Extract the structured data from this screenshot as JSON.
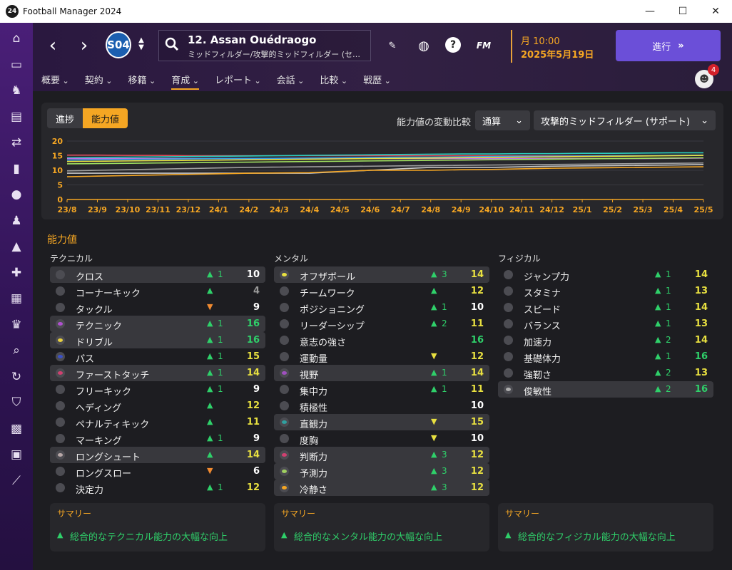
{
  "window": {
    "title": "Football Manager 2024",
    "logo_text": "24",
    "minimize": "—",
    "maximize": "☐",
    "close": "✕"
  },
  "sidebar": [
    "home-icon",
    "inbox-icon",
    "squad-icon",
    "tactics-icon",
    "transfers-icon",
    "team-report-icon",
    "scouting-icon",
    "staff-icon",
    "training-icon",
    "medical-icon",
    "schedule-icon",
    "competitions-icon",
    "search-icon",
    "transfer-centre-icon",
    "club-info-icon",
    "finances-icon",
    "dev-centre-icon",
    "career-icon"
  ],
  "header": {
    "crest_text": "S04",
    "player_name": "12. Assan Ouédraogo",
    "player_position": "ミッドフィルダー/攻撃的ミッドフィルダー (セ…",
    "time": "月 10:00",
    "date": "2025年5月19日",
    "continue_label": "進行",
    "fm_label": "FM",
    "help_label": "?",
    "notifications": "4"
  },
  "tabs": [
    "概要",
    "契約",
    "移籍",
    "育成",
    "レポート",
    "会話",
    "比較",
    "戦歴"
  ],
  "active_tab": 3,
  "segment": [
    "進捗",
    "能力値"
  ],
  "compare_label": "能力値の変動比較",
  "dropdown1": "通算",
  "dropdown2": "攻撃的ミッドフィルダー (サポート)",
  "chart_data": {
    "type": "line",
    "categories": [
      "23/8",
      "23/9",
      "23/10",
      "23/11",
      "23/12",
      "24/1",
      "24/2",
      "24/3",
      "24/4",
      "24/5",
      "24/6",
      "24/7",
      "24/8",
      "24/9",
      "24/10",
      "24/11",
      "24/12",
      "25/1",
      "25/2",
      "25/3",
      "25/4",
      "25/5"
    ],
    "ylim": [
      0,
      20
    ],
    "yticks": [
      0,
      5,
      10,
      15,
      20
    ],
    "grid": true,
    "series": [
      {
        "color": "#e04858",
        "values": [
          15.2,
          15.2,
          15.1,
          15.1,
          15.0,
          15.0,
          15.0,
          15.0,
          15.0,
          15.0,
          15.0,
          15.0,
          15.0,
          15.0,
          15.0,
          15.0,
          15.0,
          15.0,
          15.0,
          15.0,
          15.0,
          15.1
        ]
      },
      {
        "color": "#2ad0c0",
        "values": [
          14.3,
          14.4,
          14.5,
          14.6,
          14.7,
          14.8,
          14.9,
          15.0,
          15.1,
          15.2,
          15.3,
          15.4,
          15.5,
          15.6,
          15.6,
          15.7,
          15.7,
          15.8,
          15.8,
          15.9,
          16.0,
          16.0
        ]
      },
      {
        "color": "#c070e8",
        "values": [
          14.0,
          14.0,
          14.0,
          14.0,
          14.0,
          14.0,
          14.0,
          14.0,
          14.0,
          14.0,
          14.0,
          14.0,
          14.0,
          14.0,
          14.0,
          14.0,
          14.0,
          14.0,
          14.0,
          14.0,
          14.1,
          14.2
        ]
      },
      {
        "color": "#3aa0e8",
        "values": [
          13.5,
          13.6,
          13.7,
          13.8,
          13.9,
          14.0,
          14.0,
          14.1,
          14.2,
          14.3,
          14.4,
          14.5,
          14.5,
          14.6,
          14.7,
          14.8,
          14.8,
          14.9,
          15.0,
          15.0,
          15.1,
          15.2
        ]
      },
      {
        "color": "#e8e040",
        "values": [
          13.0,
          13.1,
          13.2,
          13.3,
          13.4,
          13.5,
          13.6,
          13.7,
          13.8,
          13.9,
          14.0,
          14.1,
          14.2,
          14.3,
          14.4,
          14.5,
          14.6,
          14.7,
          14.8,
          14.9,
          15.0,
          15.1
        ]
      },
      {
        "color": "#a0e060",
        "values": [
          12.2,
          12.3,
          12.4,
          12.5,
          12.6,
          12.7,
          12.8,
          12.9,
          13.0,
          13.1,
          13.2,
          13.3,
          13.4,
          13.5,
          13.6,
          13.7,
          13.8,
          13.9,
          14.0,
          14.1,
          14.2,
          14.3
        ]
      },
      {
        "color": "#9e9e9e",
        "values": [
          9.8,
          10.0,
          10.2,
          10.4,
          10.6,
          10.8,
          11.0,
          11.1,
          11.2,
          11.3,
          11.4,
          11.5,
          11.6,
          11.7,
          11.8,
          11.9,
          12.0,
          12.1,
          12.2,
          12.3,
          12.4,
          12.5
        ]
      },
      {
        "color": "#c8c8c8",
        "values": [
          9.0,
          9.0,
          9.0,
          9.0,
          9.0,
          9.0,
          9.0,
          9.0,
          9.0,
          9.5,
          10.0,
          10.5,
          11.0,
          11.0,
          11.0,
          11.2,
          11.4,
          11.5,
          11.6,
          11.7,
          11.8,
          12.0
        ]
      },
      {
        "color": "#f5a623",
        "values": [
          7.8,
          8.0,
          8.2,
          8.4,
          8.6,
          8.8,
          9.0,
          9.1,
          9.2,
          9.6,
          10.0,
          10.0,
          10.0,
          10.2,
          10.3,
          10.5,
          10.7,
          10.8,
          10.9,
          11.0,
          11.1,
          11.2
        ]
      }
    ]
  },
  "attributes_title": "能力値",
  "columns": [
    {
      "title": "テクニカル",
      "rows": [
        {
          "name": "クロス",
          "arrow": "▲",
          "arrow_color": "#2fd06a",
          "change": "1",
          "value": "10",
          "value_color": "#ffffff",
          "hl": true,
          "icon": ""
        },
        {
          "name": "コーナーキック",
          "arrow": "▲",
          "arrow_color": "#2fd06a",
          "change": "",
          "value": "4",
          "value_color": "#9a9a9a",
          "hl": false,
          "icon": ""
        },
        {
          "name": "タックル",
          "arrow": "▼",
          "arrow_color": "#f08a30",
          "change": "",
          "value": "9",
          "value_color": "#ffffff",
          "hl": false,
          "icon": ""
        },
        {
          "name": "テクニック",
          "arrow": "▲",
          "arrow_color": "#2fd06a",
          "change": "1",
          "value": "16",
          "value_color": "#2fd06a",
          "hl": true,
          "icon": "#b050d0"
        },
        {
          "name": "ドリブル",
          "arrow": "▲",
          "arrow_color": "#2fd06a",
          "change": "1",
          "value": "16",
          "value_color": "#2fd06a",
          "hl": true,
          "icon": "#e8d040"
        },
        {
          "name": "パス",
          "arrow": "▲",
          "arrow_color": "#2fd06a",
          "change": "1",
          "value": "15",
          "value_color": "#e8e040",
          "hl": false,
          "icon": "#3a50c8"
        },
        {
          "name": "ファーストタッチ",
          "arrow": "▲",
          "arrow_color": "#2fd06a",
          "change": "1",
          "value": "14",
          "value_color": "#e8e040",
          "hl": true,
          "icon": "#d04070"
        },
        {
          "name": "フリーキック",
          "arrow": "▲",
          "arrow_color": "#2fd06a",
          "change": "1",
          "value": "9",
          "value_color": "#ffffff",
          "hl": false,
          "icon": ""
        },
        {
          "name": "ヘディング",
          "arrow": "▲",
          "arrow_color": "#2fd06a",
          "change": "",
          "value": "12",
          "value_color": "#e8e040",
          "hl": false,
          "icon": ""
        },
        {
          "name": "ペナルティキック",
          "arrow": "▲",
          "arrow_color": "#2fd06a",
          "change": "",
          "value": "11",
          "value_color": "#e8e040",
          "hl": false,
          "icon": ""
        },
        {
          "name": "マーキング",
          "arrow": "▲",
          "arrow_color": "#2fd06a",
          "change": "1",
          "value": "9",
          "value_color": "#ffffff",
          "hl": false,
          "icon": ""
        },
        {
          "name": "ロングシュート",
          "arrow": "▲",
          "arrow_color": "#2fd06a",
          "change": "",
          "value": "14",
          "value_color": "#e8e040",
          "hl": true,
          "icon": "#b8a8a8"
        },
        {
          "name": "ロングスロー",
          "arrow": "▼",
          "arrow_color": "#f08a30",
          "change": "",
          "value": "6",
          "value_color": "#ffffff",
          "hl": false,
          "icon": ""
        },
        {
          "name": "決定力",
          "arrow": "▲",
          "arrow_color": "#2fd06a",
          "change": "1",
          "value": "12",
          "value_color": "#e8e040",
          "hl": false,
          "icon": ""
        }
      ]
    },
    {
      "title": "メンタル",
      "rows": [
        {
          "name": "オフザボール",
          "arrow": "▲",
          "arrow_color": "#2fd06a",
          "change": "3",
          "value": "14",
          "value_color": "#e8e040",
          "hl": true,
          "icon": "#e8e040"
        },
        {
          "name": "チームワーク",
          "arrow": "▲",
          "arrow_color": "#2fd06a",
          "change": "",
          "value": "12",
          "value_color": "#e8e040",
          "hl": false,
          "icon": ""
        },
        {
          "name": "ポジショニング",
          "arrow": "▲",
          "arrow_color": "#2fd06a",
          "change": "1",
          "value": "10",
          "value_color": "#ffffff",
          "hl": false,
          "icon": ""
        },
        {
          "name": "リーダーシップ",
          "arrow": "▲",
          "arrow_color": "#2fd06a",
          "change": "2",
          "value": "11",
          "value_color": "#e8e040",
          "hl": false,
          "icon": ""
        },
        {
          "name": "意志の強さ",
          "arrow": "",
          "arrow_color": "#2fd06a",
          "change": "",
          "value": "16",
          "value_color": "#2fd06a",
          "hl": false,
          "icon": ""
        },
        {
          "name": "運動量",
          "arrow": "▼",
          "arrow_color": "#e8e040",
          "change": "",
          "value": "12",
          "value_color": "#e8e040",
          "hl": false,
          "icon": ""
        },
        {
          "name": "視野",
          "arrow": "▲",
          "arrow_color": "#2fd06a",
          "change": "1",
          "value": "14",
          "value_color": "#e8e040",
          "hl": true,
          "icon": "#a050c0"
        },
        {
          "name": "集中力",
          "arrow": "▲",
          "arrow_color": "#2fd06a",
          "change": "1",
          "value": "11",
          "value_color": "#e8e040",
          "hl": false,
          "icon": ""
        },
        {
          "name": "積極性",
          "arrow": "",
          "arrow_color": "#2fd06a",
          "change": "",
          "value": "10",
          "value_color": "#ffffff",
          "hl": false,
          "icon": ""
        },
        {
          "name": "直観力",
          "arrow": "▼",
          "arrow_color": "#e8e040",
          "change": "",
          "value": "15",
          "value_color": "#e8e040",
          "hl": true,
          "icon": "#30a0a0"
        },
        {
          "name": "度胸",
          "arrow": "▼",
          "arrow_color": "#e8e040",
          "change": "",
          "value": "10",
          "value_color": "#ffffff",
          "hl": false,
          "icon": ""
        },
        {
          "name": "判断力",
          "arrow": "▲",
          "arrow_color": "#2fd06a",
          "change": "3",
          "value": "12",
          "value_color": "#e8e040",
          "hl": true,
          "icon": "#d04070"
        },
        {
          "name": "予測力",
          "arrow": "▲",
          "arrow_color": "#2fd06a",
          "change": "3",
          "value": "12",
          "value_color": "#e8e040",
          "hl": true,
          "icon": "#a0d060"
        },
        {
          "name": "冷静さ",
          "arrow": "▲",
          "arrow_color": "#2fd06a",
          "change": "3",
          "value": "12",
          "value_color": "#e8e040",
          "hl": true,
          "icon": "#f5a623"
        }
      ]
    },
    {
      "title": "フィジカル",
      "rows": [
        {
          "name": "ジャンプ力",
          "arrow": "▲",
          "arrow_color": "#2fd06a",
          "change": "1",
          "value": "14",
          "value_color": "#e8e040",
          "hl": false,
          "icon": ""
        },
        {
          "name": "スタミナ",
          "arrow": "▲",
          "arrow_color": "#2fd06a",
          "change": "1",
          "value": "13",
          "value_color": "#e8e040",
          "hl": false,
          "icon": ""
        },
        {
          "name": "スピード",
          "arrow": "▲",
          "arrow_color": "#2fd06a",
          "change": "1",
          "value": "14",
          "value_color": "#e8e040",
          "hl": false,
          "icon": ""
        },
        {
          "name": "バランス",
          "arrow": "▲",
          "arrow_color": "#2fd06a",
          "change": "1",
          "value": "13",
          "value_color": "#e8e040",
          "hl": false,
          "icon": ""
        },
        {
          "name": "加速力",
          "arrow": "▲",
          "arrow_color": "#2fd06a",
          "change": "2",
          "value": "14",
          "value_color": "#e8e040",
          "hl": false,
          "icon": ""
        },
        {
          "name": "基礎体力",
          "arrow": "▲",
          "arrow_color": "#2fd06a",
          "change": "1",
          "value": "16",
          "value_color": "#2fd06a",
          "hl": false,
          "icon": ""
        },
        {
          "name": "強靭さ",
          "arrow": "▲",
          "arrow_color": "#2fd06a",
          "change": "2",
          "value": "13",
          "value_color": "#e8e040",
          "hl": false,
          "icon": ""
        },
        {
          "name": "俊敏性",
          "arrow": "▲",
          "arrow_color": "#2fd06a",
          "change": "2",
          "value": "16",
          "value_color": "#2fd06a",
          "hl": true,
          "icon": "#b0b0b0"
        }
      ]
    }
  ],
  "summaries": [
    {
      "title": "サマリー",
      "text": "総合的なテクニカル能力の大幅な向上"
    },
    {
      "title": "サマリー",
      "text": "総合的なメンタル能力の大幅な向上"
    },
    {
      "title": "サマリー",
      "text": "総合的なフィジカル能力の大幅な向上"
    }
  ]
}
